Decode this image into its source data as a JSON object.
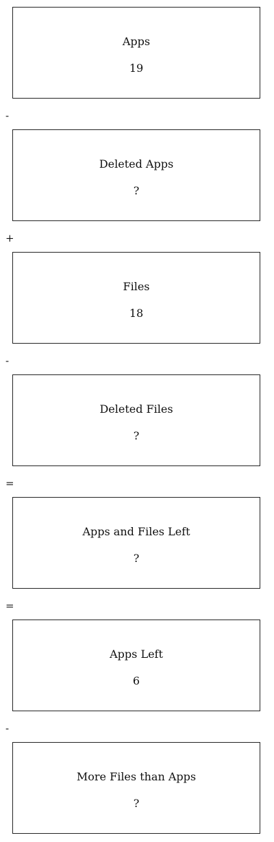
{
  "boxes": [
    {
      "label": "Apps",
      "value": "19"
    },
    {
      "label": "Deleted Apps",
      "value": "?"
    },
    {
      "label": "Files",
      "value": "18"
    },
    {
      "label": "Deleted Files",
      "value": "?"
    },
    {
      "label": "Apps and Files Left",
      "value": "?"
    },
    {
      "label": "Apps Left",
      "value": "6"
    },
    {
      "label": "More Files than Apps",
      "value": "?"
    }
  ],
  "operators": [
    "-",
    "+",
    "-",
    "=",
    "=",
    "-"
  ]
}
